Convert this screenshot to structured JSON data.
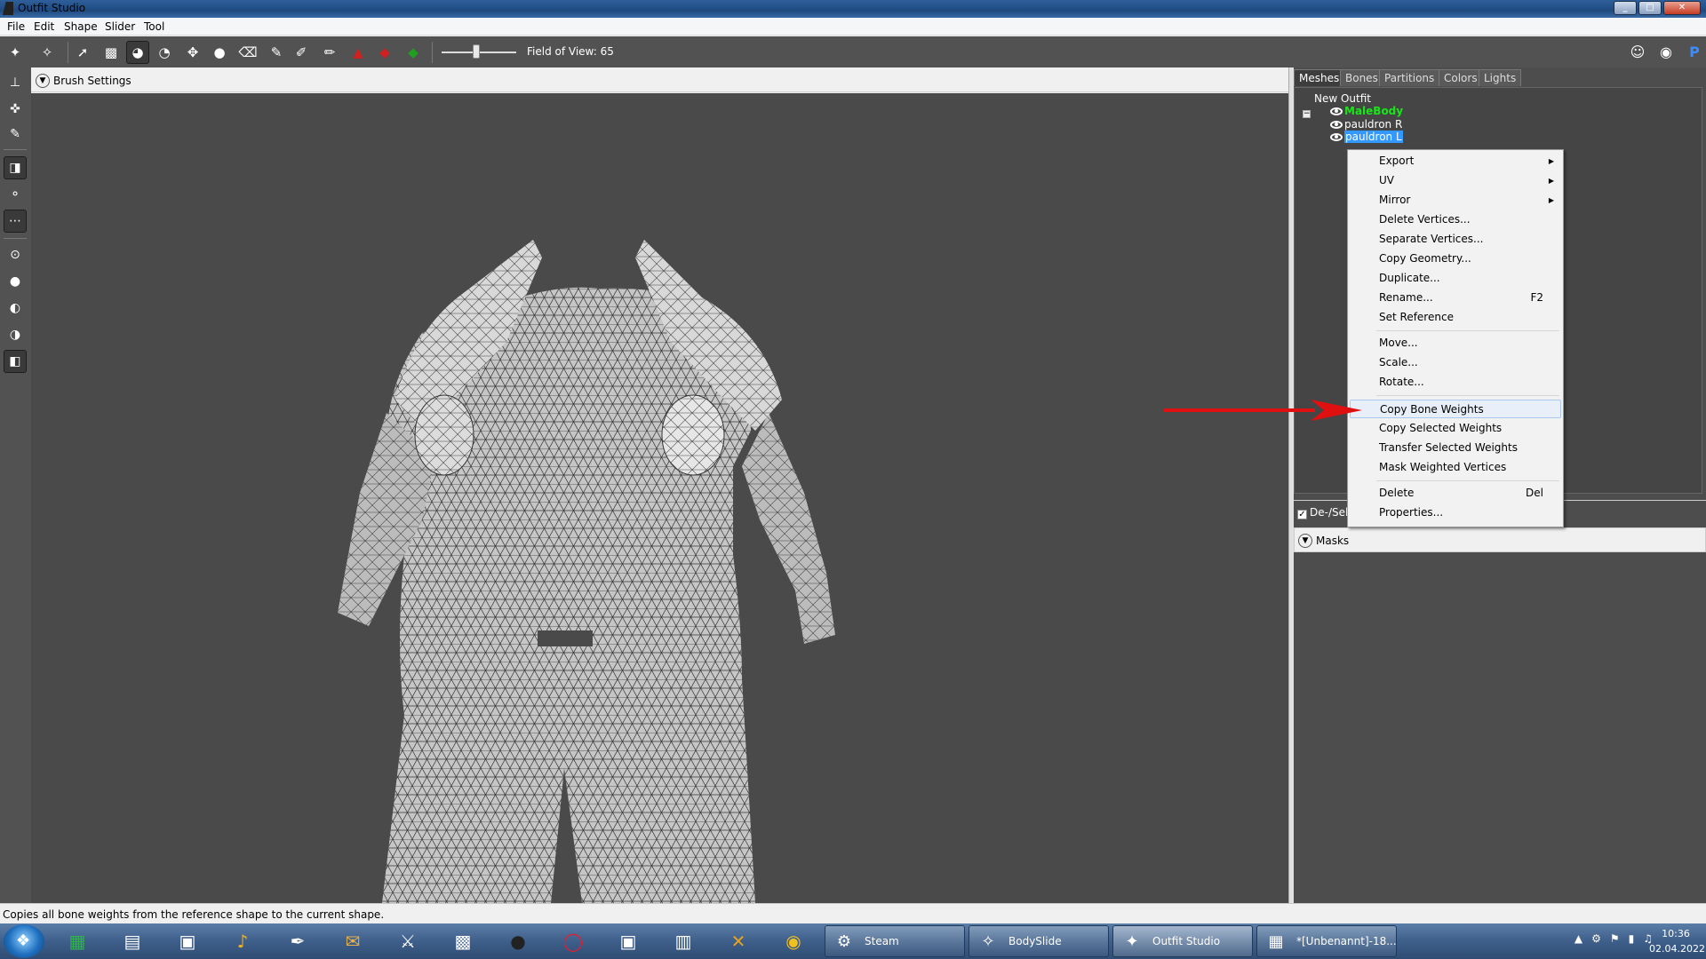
{
  "window": {
    "title": "Outfit Studio"
  },
  "menubar": {
    "items": [
      "File",
      "Edit",
      "Shape",
      "Slider",
      "Tool"
    ]
  },
  "toolbar": {
    "fov_label": "Field of View: 65"
  },
  "brush_settings": {
    "label": "Brush Settings"
  },
  "panel": {
    "tabs": [
      "Meshes",
      "Bones",
      "Partitions",
      "Colors",
      "Lights"
    ],
    "active_tab": "Meshes",
    "tree": {
      "root": "New Outfit",
      "items": [
        {
          "label": "MaleBody",
          "color": "#19e619"
        },
        {
          "label": "pauldron R",
          "color": "#ffffff"
        },
        {
          "label": "pauldron L",
          "color": "#ffffff",
          "selected": true
        }
      ]
    },
    "deselect_label": "De-/Sele",
    "masks_label": "Masks"
  },
  "context_menu": {
    "items": [
      {
        "label": "Export",
        "submenu": true
      },
      {
        "label": "UV",
        "submenu": true
      },
      {
        "label": "Mirror",
        "submenu": true
      },
      {
        "label": "Delete Vertices..."
      },
      {
        "label": "Separate Vertices..."
      },
      {
        "label": "Copy Geometry..."
      },
      {
        "label": "Duplicate..."
      },
      {
        "label": "Rename...",
        "shortcut": "F2"
      },
      {
        "label": "Set Reference"
      },
      {
        "label": "Move..."
      },
      {
        "label": "Scale..."
      },
      {
        "label": "Rotate..."
      },
      {
        "label": "Copy Bone Weights",
        "highlighted": true
      },
      {
        "label": "Copy Selected Weights"
      },
      {
        "label": "Transfer Selected Weights"
      },
      {
        "label": "Mask Weighted Vertices"
      },
      {
        "label": "Delete",
        "shortcut": "Del"
      },
      {
        "label": "Properties..."
      }
    ]
  },
  "statusbar": {
    "message": "Copies all bone weights from the reference shape to the current shape."
  },
  "taskbar": {
    "tasks": [
      {
        "label": "Steam"
      },
      {
        "label": "BodySlide"
      },
      {
        "label": "Outfit Studio",
        "active": true
      },
      {
        "label": "*[Unbenannt]-18...."
      }
    ],
    "clock": {
      "time": "10:36",
      "date": "02.04.2022"
    }
  },
  "colors": {
    "accent_selection": "#3399ff",
    "arrow": "#e01010",
    "viewport_bg": "#4a4a4a"
  }
}
